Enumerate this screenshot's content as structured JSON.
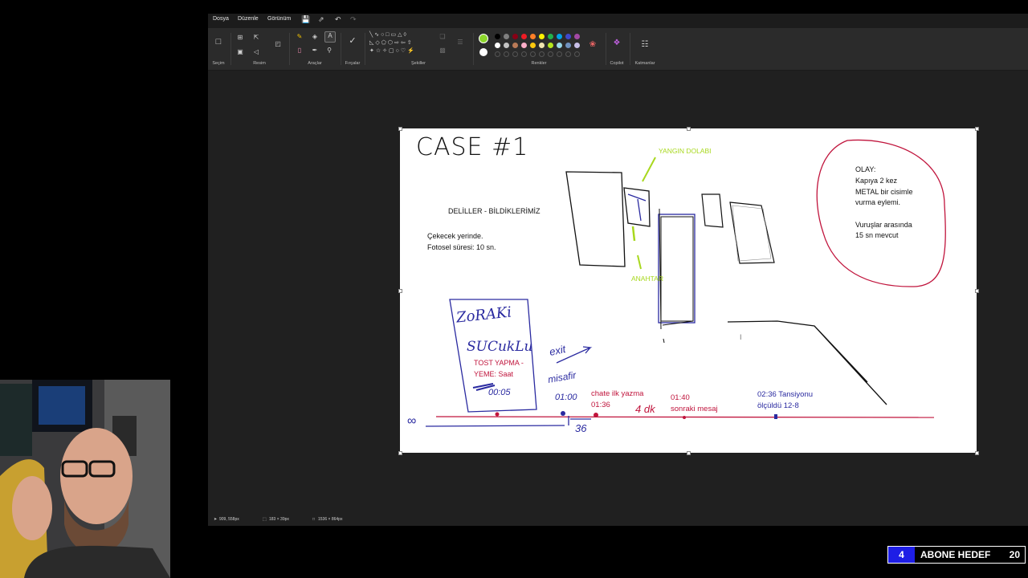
{
  "menu": {
    "file": "Dosya",
    "edit": "Düzenle",
    "view": "Görünüm"
  },
  "quick_access": {
    "save_icon": "save-icon",
    "share_icon": "share-icon",
    "undo_icon": "undo-icon",
    "redo_icon": "redo-icon"
  },
  "ribbon": {
    "groups": {
      "selection": "Seçim",
      "image": "Resim",
      "tools": "Araçlar",
      "brushes": "Fırçalar",
      "shapes": "Şekiller",
      "colors": "Renkler",
      "copilot": "Copilot",
      "layers": "Katmanlar"
    },
    "active_color": "#8cd62c",
    "secondary_color": "#ffffff",
    "palette": [
      "#000000",
      "#7f7f7f",
      "#880015",
      "#ed1c24",
      "#ff7f27",
      "#fff200",
      "#22b14c",
      "#00a2e8",
      "#3f48cc",
      "#a349a4",
      "#ffffff",
      "#c3c3c3",
      "#b97a57",
      "#ffaec9",
      "#ffc90e",
      "#efe4b0",
      "#b5e61d",
      "#99d9ea",
      "#7092be",
      "#c8bfe7"
    ]
  },
  "canvas": {
    "title": "CASE #1",
    "evidence_heading": "DELİLLER - BİLDİKLERİMİZ",
    "evidence_lines": [
      "Çekecek yerinde.",
      "Fotosel süresi: 10 sn."
    ],
    "fire_cabinet_label": "YANGIN DOLABI",
    "key_label": "ANAHTAR",
    "event_lines": [
      "OLAY:",
      "Kapıya 2 kez",
      "METAL bir cisimle",
      "vurma eylemi.",
      "",
      "Vuruşlar arasında",
      "15 sn mevcut"
    ],
    "zoraki": "ZoRAKi",
    "sucuklu": "SUCukLu",
    "toast_lines": [
      "TOST YAPMA -",
      "YEME: Saat"
    ],
    "toast_time": "00:05",
    "exit_label": "exit",
    "guest_label": "misafir",
    "guest_time": "01:00",
    "chat_lines": [
      "chate ilk yazma",
      "01:36"
    ],
    "four_min": "4 dk",
    "next_msg_lines": [
      "01:40",
      "sonraki mesaj"
    ],
    "bp_lines": [
      "02:36 Tansiyonu",
      "ölçüldü 12-8"
    ],
    "infinity": "∞",
    "thirty_six": "36",
    "cursor_mark": "I"
  },
  "status": {
    "cursor_pos": "909, 558px",
    "selection_size": "183 × 39px",
    "canvas_size": "1536 × 864px"
  },
  "overlay": {
    "goal_count": "4",
    "goal_label": "ABONE HEDEF",
    "goal_target": "20"
  }
}
